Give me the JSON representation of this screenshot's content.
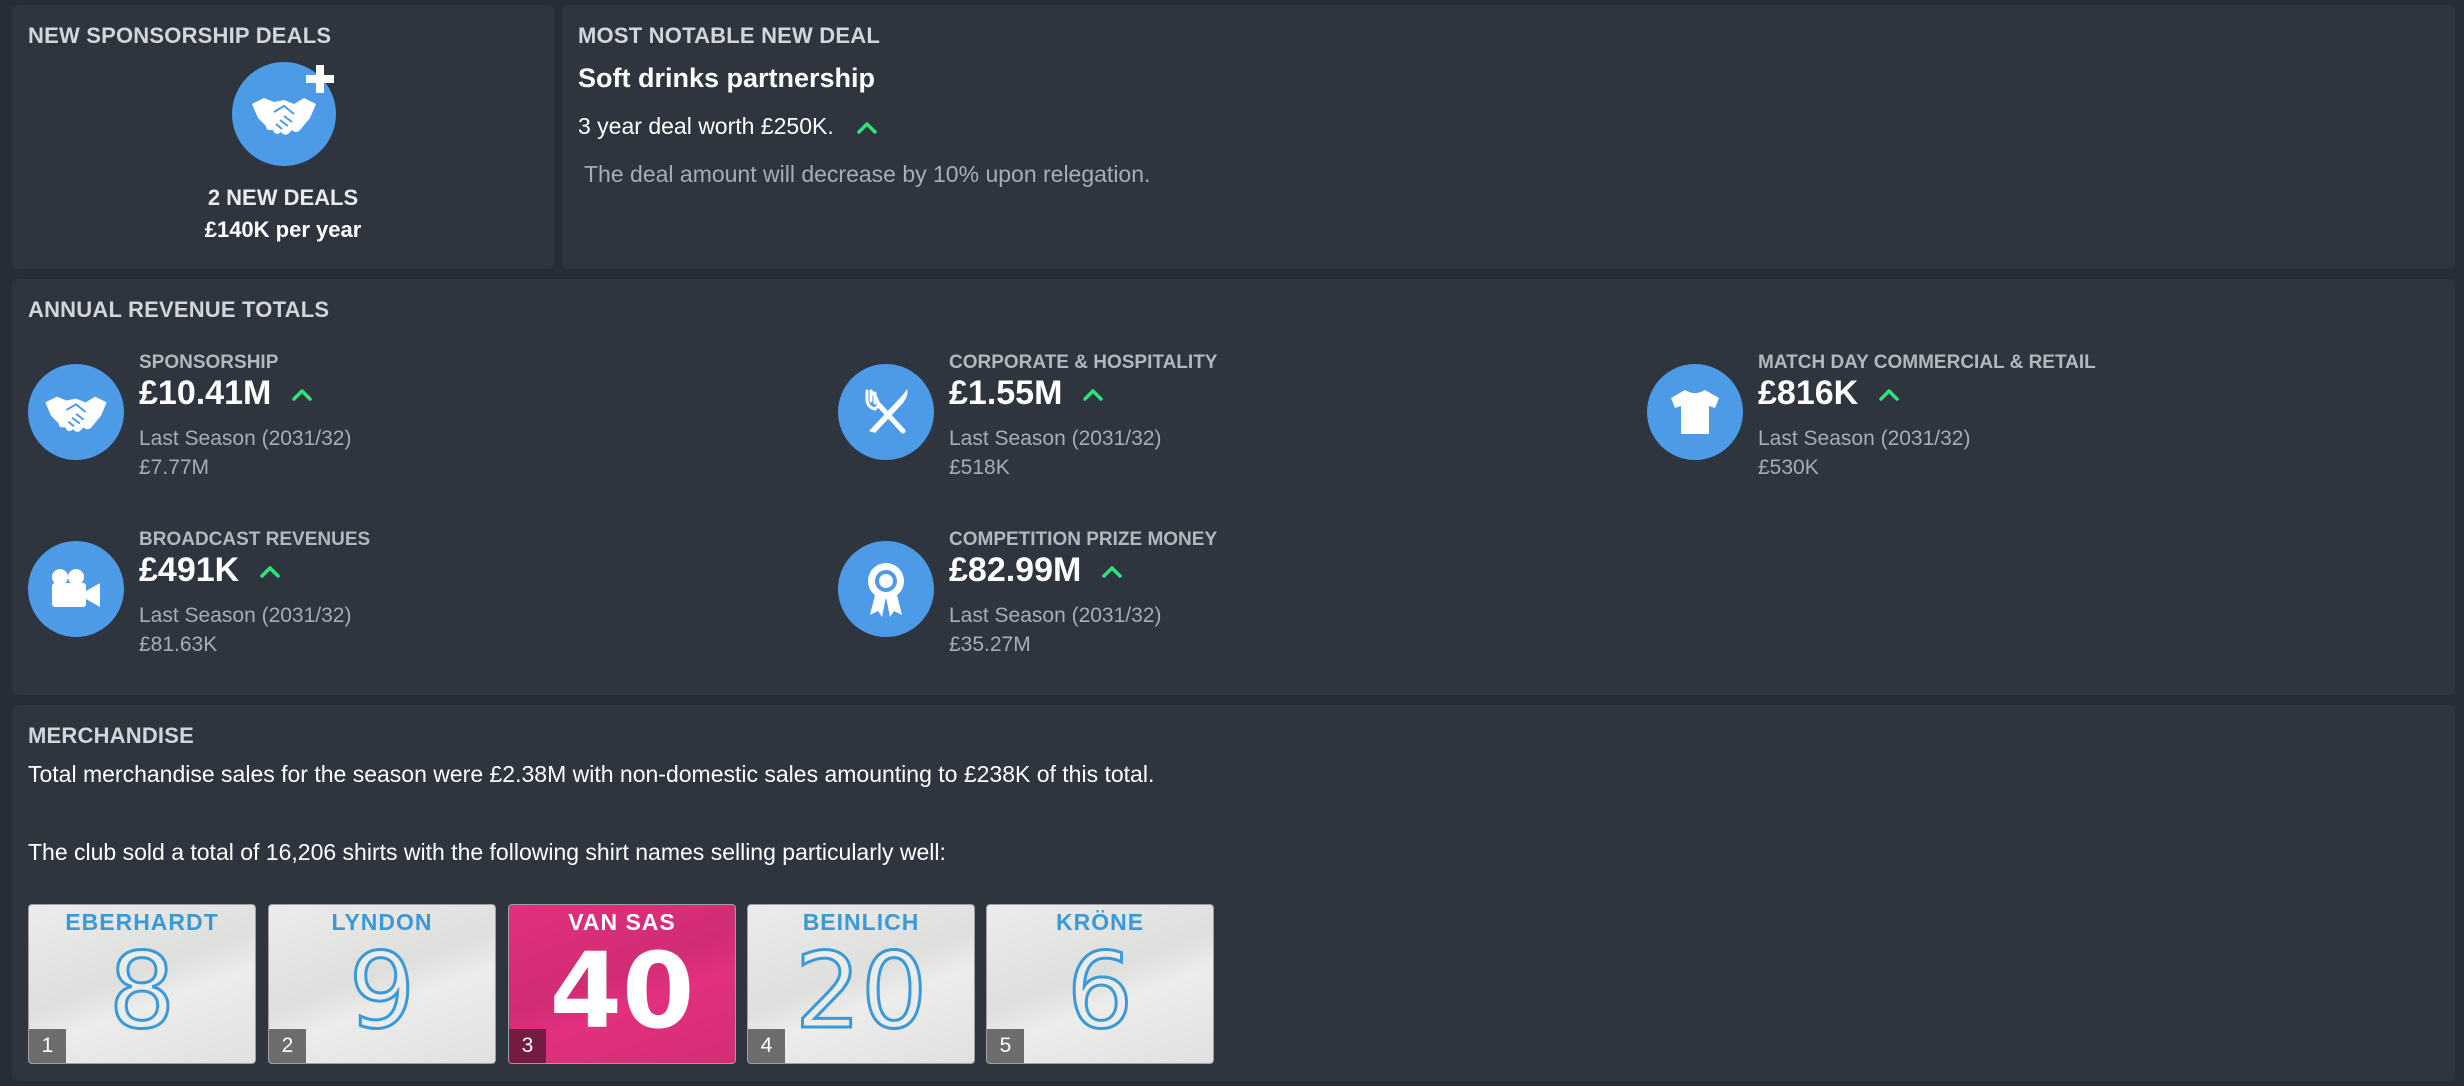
{
  "new_deals": {
    "title": "NEW SPONSORSHIP DEALS",
    "count": "2 NEW DEALS",
    "per_year": "£140K per year"
  },
  "notable_deal": {
    "title": "MOST NOTABLE NEW DEAL",
    "name": "Soft drinks partnership",
    "terms": "3 year deal worth £250K.",
    "note": "The deal amount will decrease by 10% upon relegation."
  },
  "revenue": {
    "title": "ANNUAL REVENUE TOTALS",
    "items": [
      {
        "label": "SPONSORSHIP",
        "value": "£10.41M",
        "last_label": "Last Season (2031/32)",
        "last_value": "£7.77M",
        "icon": "handshake-icon",
        "trend": "up"
      },
      {
        "label": "CORPORATE & HOSPITALITY",
        "value": "£1.55M",
        "last_label": "Last Season (2031/32)",
        "last_value": "£518K",
        "icon": "cutlery-icon",
        "trend": "up"
      },
      {
        "label": "MATCH DAY COMMERCIAL & RETAIL",
        "value": "£816K",
        "last_label": "Last Season (2031/32)",
        "last_value": "£530K",
        "icon": "shirt-icon",
        "trend": "up"
      },
      {
        "label": "BROADCAST REVENUES",
        "value": "£491K",
        "last_label": "Last Season (2031/32)",
        "last_value": "£81.63K",
        "icon": "camera-icon",
        "trend": "up"
      },
      {
        "label": "COMPETITION PRIZE MONEY",
        "value": "£82.99M",
        "last_label": "Last Season (2031/32)",
        "last_value": "£35.27M",
        "icon": "award-ribbon-icon",
        "trend": "up"
      }
    ]
  },
  "merchandise": {
    "title": "MERCHANDISE",
    "summary": "Total merchandise sales for the season were £2.38M with non-domestic sales amounting to £238K of this total.",
    "shirts_text": "The club sold a total of 16,206 shirts with the following shirt names selling particularly well:",
    "shirts": [
      {
        "rank": "1",
        "name": "EBERHARDT",
        "number": "8",
        "style": "white"
      },
      {
        "rank": "2",
        "name": "LYNDON",
        "number": "9",
        "style": "white"
      },
      {
        "rank": "3",
        "name": "VAN SAS",
        "number": "40",
        "style": "pink"
      },
      {
        "rank": "4",
        "name": "BEINLICH",
        "number": "20",
        "style": "white"
      },
      {
        "rank": "5",
        "name": "KRÖNE",
        "number": "6",
        "style": "white"
      }
    ]
  },
  "colors": {
    "background": "#262d36",
    "panel": "#2e353f",
    "icon_circle": "#4d9ae6",
    "trend_up": "#2ee37a",
    "shirt_blue": "#3a9ad8",
    "shirt_pink": "#e2307e"
  }
}
